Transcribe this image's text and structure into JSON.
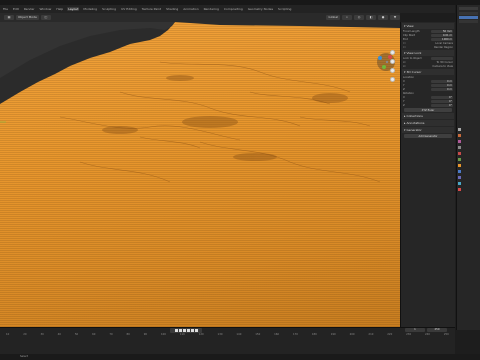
{
  "window": {
    "title": ""
  },
  "menubar": {
    "tabs": [
      "File",
      "Edit",
      "Render",
      "Window",
      "Help",
      "Layout",
      "Modeling",
      "Sculpting",
      "UV Editing",
      "Texture Paint",
      "Shading",
      "Animation",
      "Rendering",
      "Compositing",
      "Geometry Nodes",
      "Scripting"
    ],
    "active_index": 5
  },
  "header": {
    "mode": "Object Mode",
    "shading": "Global"
  },
  "npanel": {
    "view_title": "View",
    "view_rows": [
      {
        "label": "Focal Length",
        "value": "50 mm"
      },
      {
        "label": "Clip Start",
        "value": "0.01 m"
      },
      {
        "label": "End",
        "value": "1000 m"
      }
    ],
    "local_camera": "Local Camera",
    "render_region": "Render Region",
    "view_lock_title": "View Lock",
    "lock_to_object": "Lock to Object",
    "lock_3d_cursor": "To 3D Cursor",
    "lock_camera": "Camera to View",
    "cursor_title": "3D Cursor",
    "location_label": "Location",
    "location": [
      {
        "axis": "X",
        "value": "0 m"
      },
      {
        "axis": "Y",
        "value": "0 m"
      },
      {
        "axis": "Z",
        "value": "0 m"
      }
    ],
    "rotation_label": "Rotation",
    "rotation": [
      {
        "axis": "X",
        "value": "0°"
      },
      {
        "axis": "Y",
        "value": "0°"
      },
      {
        "axis": "Z",
        "value": "0°"
      }
    ],
    "rotation_mode": "XYZ Euler",
    "collections_title": "Collections",
    "annotations_title": "Annotations",
    "generator_title": "Generator",
    "bottom_btn": "Add Generator"
  },
  "timeline": {
    "ticks": [
      "10",
      "20",
      "30",
      "40",
      "50",
      "60",
      "70",
      "80",
      "90",
      "100",
      "110",
      "120",
      "130",
      "140",
      "150",
      "160",
      "170",
      "180",
      "190",
      "200",
      "210",
      "220",
      "230",
      "240",
      "250"
    ],
    "start": "1",
    "end": "250"
  },
  "statusbar": {
    "text": "Select"
  },
  "colors": {
    "terrain": "#e8962c",
    "accent": "#4772b3",
    "bg": "#1d1d1d"
  }
}
